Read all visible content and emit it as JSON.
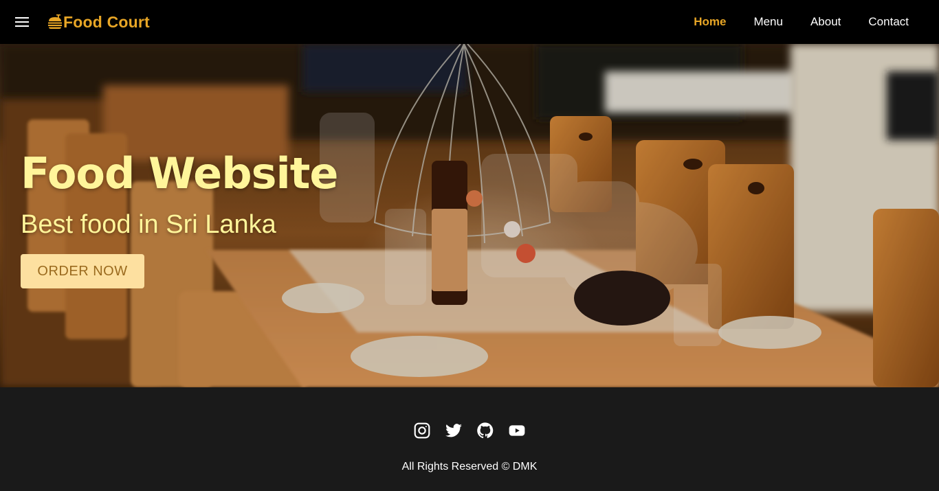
{
  "colors": {
    "accent": "#e8a626",
    "hero_text": "#fff59a",
    "button_bg": "#fde0a0",
    "button_text": "#9a6a1e",
    "nav_bg": "#000000",
    "footer_bg": "#1a1a1a"
  },
  "navbar": {
    "menu_icon": "hamburger-icon",
    "brand": {
      "icon": "burger-icon",
      "name": "Food Court"
    },
    "links": [
      {
        "label": "Home",
        "active": true
      },
      {
        "label": "Menu",
        "active": false
      },
      {
        "label": "About",
        "active": false
      },
      {
        "label": "Contact",
        "active": false
      }
    ]
  },
  "hero": {
    "background": "restaurant-dining-table-photo",
    "title": "Food Website",
    "subtitle": "Best food in Sri Lanka",
    "cta_label": "ORDER NOW"
  },
  "footer": {
    "social": [
      {
        "icon": "instagram-icon"
      },
      {
        "icon": "twitter-icon"
      },
      {
        "icon": "github-icon"
      },
      {
        "icon": "youtube-icon"
      }
    ],
    "copyright": "All Rights Reserved © DMK"
  }
}
